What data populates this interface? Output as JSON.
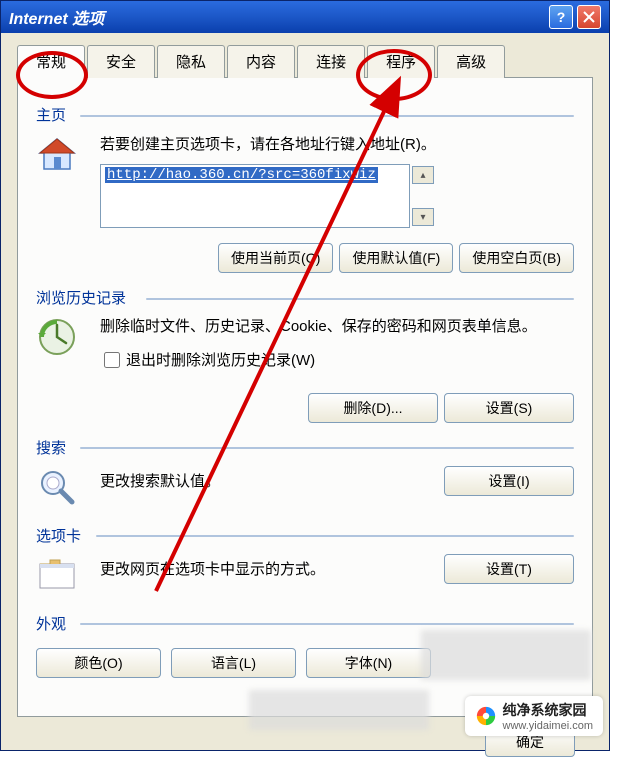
{
  "window": {
    "title": "Internet 选项"
  },
  "tabs": [
    {
      "label": "常规"
    },
    {
      "label": "安全"
    },
    {
      "label": "隐私"
    },
    {
      "label": "内容"
    },
    {
      "label": "连接"
    },
    {
      "label": "程序"
    },
    {
      "label": "高级"
    }
  ],
  "homepage": {
    "title": "主页",
    "instruction": "若要创建主页选项卡，请在各地址行键入地址(R)。",
    "url": "http://hao.360.cn/?src=360fixwiz",
    "btn_current": "使用当前页(C)",
    "btn_default": "使用默认值(F)",
    "btn_blank": "使用空白页(B)"
  },
  "history": {
    "title": "浏览历史记录",
    "instruction": "删除临时文件、历史记录、Cookie、保存的密码和网页表单信息。",
    "checkbox": "退出时删除浏览历史记录(W)",
    "btn_delete": "删除(D)...",
    "btn_settings": "设置(S)"
  },
  "search": {
    "title": "搜索",
    "instruction": "更改搜索默认值。",
    "btn_settings": "设置(I)"
  },
  "tabs_section": {
    "title": "选项卡",
    "instruction": "更改网页在选项卡中显示的方式。",
    "btn_settings": "设置(T)"
  },
  "appearance": {
    "title": "外观",
    "btn_color": "颜色(O)",
    "btn_language": "语言(L)",
    "btn_font": "字体(N)"
  },
  "dialog": {
    "ok": "确定"
  },
  "watermark": {
    "name": "纯净系统家园",
    "url": "www.yidaimei.com"
  }
}
